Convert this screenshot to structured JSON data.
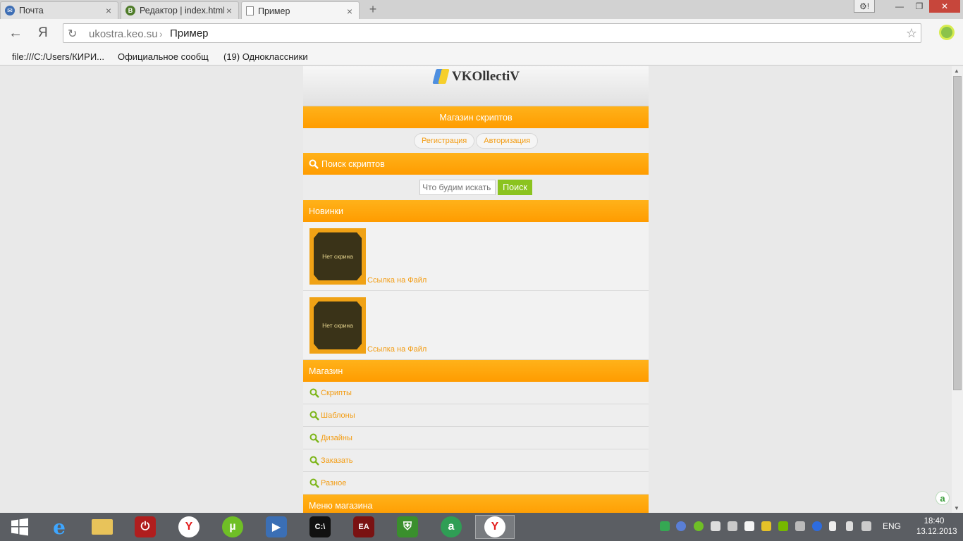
{
  "browser": {
    "tabs": [
      {
        "label": "Почта",
        "icon": "mail-icon",
        "active": false
      },
      {
        "label": "Редактор | index.html",
        "icon": "editor-icon",
        "active": false
      },
      {
        "label": "Пример",
        "icon": "page-icon",
        "active": true
      }
    ],
    "new_tab_glyph": "+",
    "window": {
      "settings_glyph": "⚙!",
      "minimize_glyph": "—",
      "maximize_glyph": "❐",
      "close_glyph": "✕"
    },
    "toolbar": {
      "back_glyph": "←",
      "yandex_glyph": "Я",
      "reload_glyph": "↻"
    },
    "address": {
      "host": "ukostra.keo.su",
      "separator": "›",
      "page_title": "Пример",
      "star_glyph": "☆"
    },
    "bookmarks": [
      "file:///C:/Users/КИРИ...",
      "Официальное сообщ...",
      "(19) Одноклассники"
    ]
  },
  "site": {
    "logo_text": "VKOllectiV",
    "shop_bar": "Магазин скриптов",
    "auth": {
      "register": "Регистрация",
      "login": "Авторизация"
    },
    "search": {
      "title": "Поиск скриптов",
      "placeholder": "Что будим искать",
      "button": "Поиск"
    },
    "news": {
      "title": "Новинки",
      "items": [
        {
          "thumb_text": "Нет скрина",
          "link": "Ссылка на Файл"
        },
        {
          "thumb_text": "Нет скрина",
          "link": "Ссылка на Файл"
        }
      ]
    },
    "shop": {
      "title": "Магазин",
      "items": [
        "Скрипты",
        "Шаблоны",
        "Дизайны",
        "Заказать",
        "Разное"
      ]
    },
    "shop_menu_title": "Меню магазина"
  },
  "page_badge": "a",
  "taskbar": {
    "lang": "ENG",
    "time": "18:40",
    "date": "13.12.2013"
  },
  "colors": {
    "accent": "#ff9f00",
    "link": "#f39c12",
    "search_button": "#8bc31f"
  }
}
